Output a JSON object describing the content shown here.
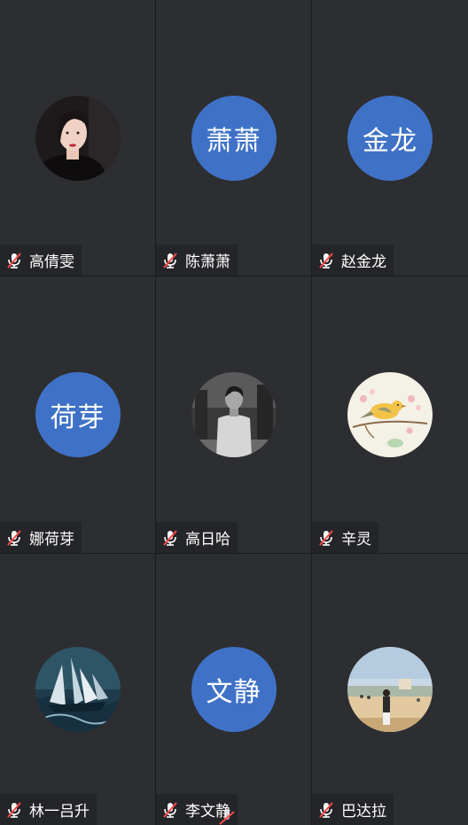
{
  "participants": [
    {
      "name": "高倩雯",
      "avatar_type": "photo",
      "avatar_icon": "portrait-woman-photo",
      "muted": true
    },
    {
      "name": "陈萧萧",
      "avatar_type": "text",
      "avatar_text": "萧萧",
      "muted": true
    },
    {
      "name": "赵金龙",
      "avatar_type": "text",
      "avatar_text": "金龙",
      "muted": true
    },
    {
      "name": "娜荷芽",
      "avatar_type": "text",
      "avatar_text": "荷芽",
      "muted": true
    },
    {
      "name": "高日哈",
      "avatar_type": "photo",
      "avatar_icon": "portrait-man-bw-photo",
      "muted": true
    },
    {
      "name": "辛灵",
      "avatar_type": "photo",
      "avatar_icon": "bird-painting-photo",
      "muted": true
    },
    {
      "name": "林一吕升",
      "avatar_type": "photo",
      "avatar_icon": "ship-painting-photo",
      "muted": true
    },
    {
      "name": "李文静",
      "avatar_type": "text",
      "avatar_text": "文静",
      "muted": true
    },
    {
      "name": "巴达拉",
      "avatar_type": "photo",
      "avatar_icon": "beach-person-photo",
      "muted": true
    }
  ],
  "colors": {
    "tile_bg": "#2d2e31",
    "name_bar_bg": "#242528",
    "text_avatar_bg": "#3f72c7",
    "muted_icon": "#ff4a4a"
  }
}
